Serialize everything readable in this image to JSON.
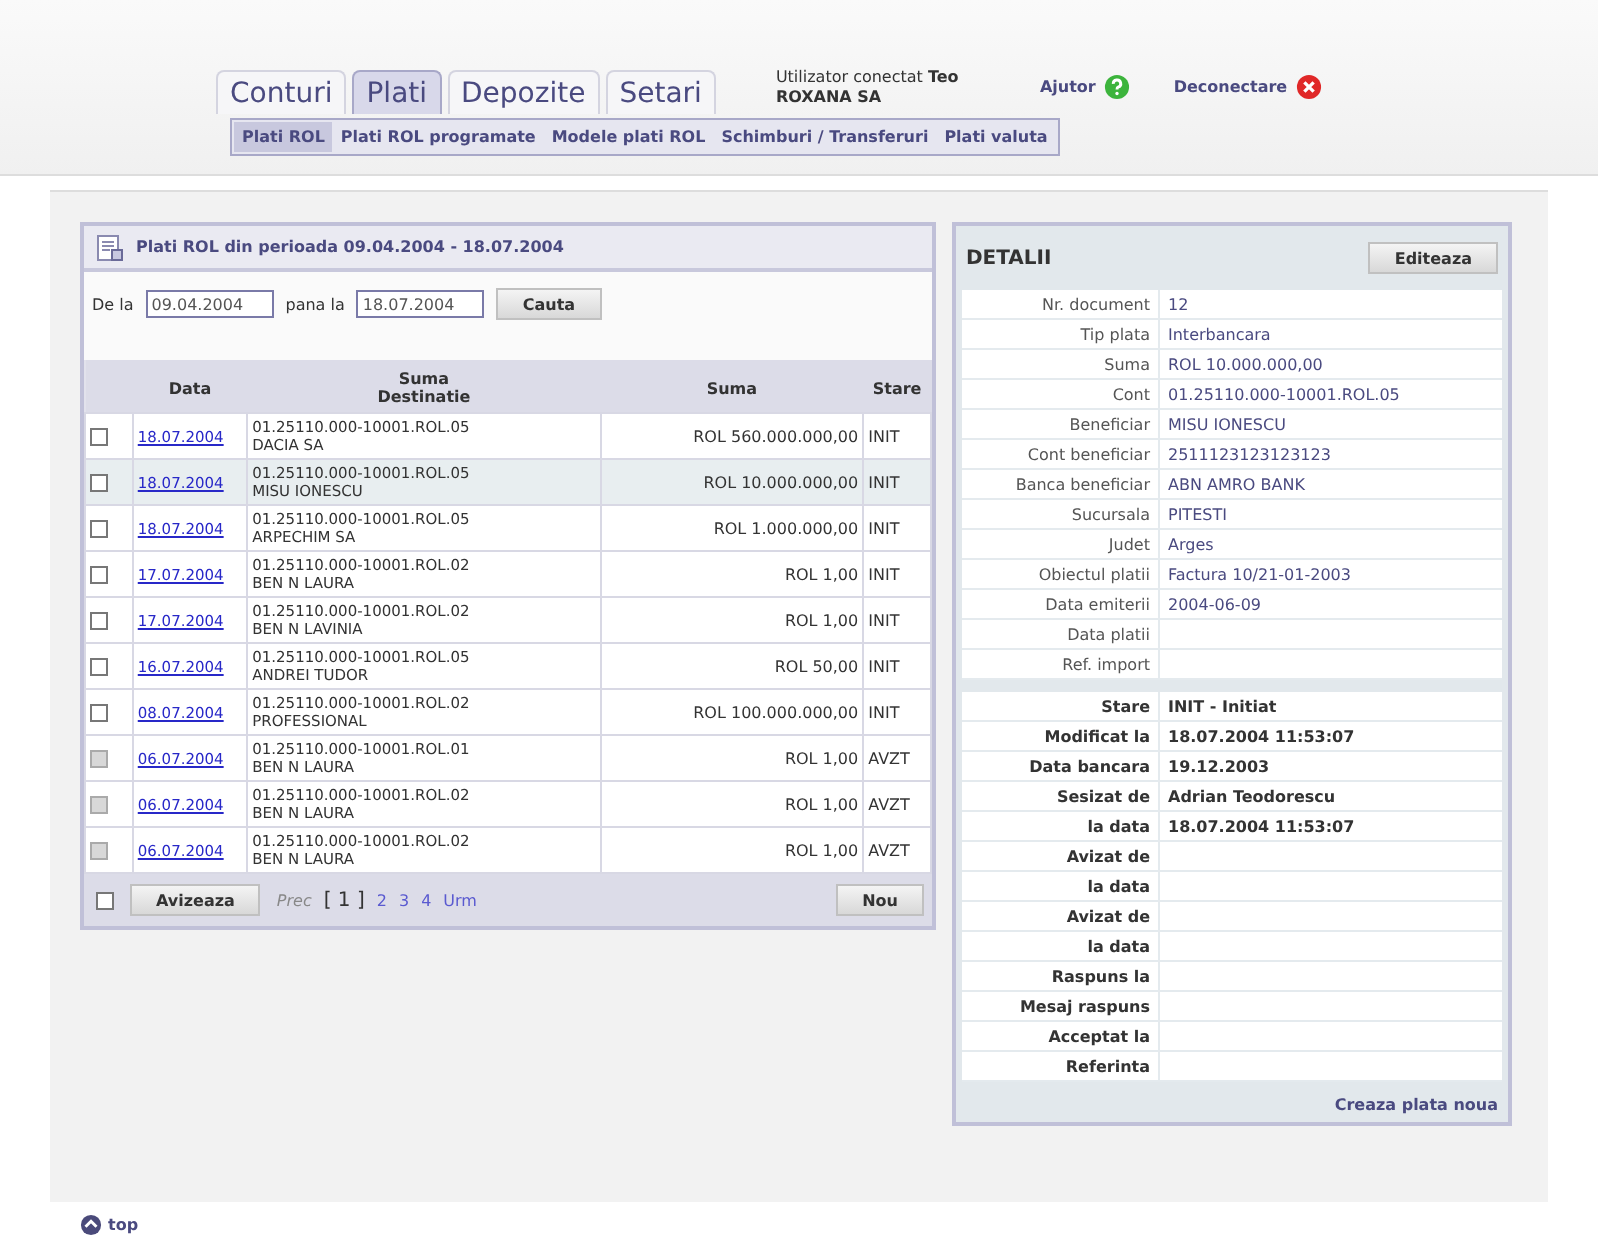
{
  "tabs": [
    {
      "label": "Conturi",
      "selected": false
    },
    {
      "label": "Plati",
      "selected": true
    },
    {
      "label": "Depozite",
      "selected": false
    },
    {
      "label": "Setari",
      "selected": false
    }
  ],
  "user": {
    "label": "Utilizator conectat",
    "name": "Teo",
    "company": "ROXANA SA"
  },
  "help_link": "Ajutor",
  "logout_link": "Deconectare",
  "subtabs": [
    {
      "label": "Plati ROL",
      "selected": true
    },
    {
      "label": "Plati ROL programate",
      "selected": false
    },
    {
      "label": "Modele plati ROL",
      "selected": false
    },
    {
      "label": "Schimburi / Transferuri",
      "selected": false
    },
    {
      "label": "Plati valuta",
      "selected": false
    }
  ],
  "payments": {
    "title": "Plati ROL din perioada 09.04.2004 - 18.07.2004",
    "filter": {
      "from_label": "De la",
      "from_value": "09.04.2004",
      "to_label": "pana la",
      "to_value": "18.07.2004",
      "button": "Cauta"
    },
    "columns": [
      "Data",
      "Suma\nDestinatie",
      "Suma",
      "Stare"
    ],
    "rows": [
      {
        "date": "18.07.2004",
        "account": "01.25110.000-10001.ROL.05",
        "destination": "DACIA SA",
        "amount": "ROL 560.000.000,00",
        "status": "INIT",
        "selected": false,
        "checked": false,
        "disabled": false
      },
      {
        "date": "18.07.2004",
        "account": "01.25110.000-10001.ROL.05",
        "destination": "MISU IONESCU",
        "amount": "ROL 10.000.000,00",
        "status": "INIT",
        "selected": true,
        "checked": false,
        "disabled": false
      },
      {
        "date": "18.07.2004",
        "account": "01.25110.000-10001.ROL.05",
        "destination": "ARPECHIM SA",
        "amount": "ROL 1.000.000,00",
        "status": "INIT",
        "selected": false,
        "checked": false,
        "disabled": false
      },
      {
        "date": "17.07.2004",
        "account": "01.25110.000-10001.ROL.02",
        "destination": "BEN N LAURA",
        "amount": "ROL 1,00",
        "status": "INIT",
        "selected": false,
        "checked": false,
        "disabled": false
      },
      {
        "date": "17.07.2004",
        "account": "01.25110.000-10001.ROL.02",
        "destination": "BEN N LAVINIA",
        "amount": "ROL 1,00",
        "status": "INIT",
        "selected": false,
        "checked": false,
        "disabled": false
      },
      {
        "date": "16.07.2004",
        "account": "01.25110.000-10001.ROL.05",
        "destination": "ANDREI TUDOR",
        "amount": "ROL 50,00",
        "status": "INIT",
        "selected": false,
        "checked": false,
        "disabled": false
      },
      {
        "date": "08.07.2004",
        "account": "01.25110.000-10001.ROL.02",
        "destination": "PROFESSIONAL",
        "amount": "ROL 100.000.000,00",
        "status": "INIT",
        "selected": false,
        "checked": false,
        "disabled": false
      },
      {
        "date": "06.07.2004",
        "account": "01.25110.000-10001.ROL.01",
        "destination": "BEN N LAURA",
        "amount": "ROL 1,00",
        "status": "AVZT",
        "selected": false,
        "checked": false,
        "disabled": true
      },
      {
        "date": "06.07.2004",
        "account": "01.25110.000-10001.ROL.02",
        "destination": "BEN N LAURA",
        "amount": "ROL 1,00",
        "status": "AVZT",
        "selected": false,
        "checked": false,
        "disabled": true
      },
      {
        "date": "06.07.2004",
        "account": "01.25110.000-10001.ROL.02",
        "destination": "BEN N LAURA",
        "amount": "ROL 1,00",
        "status": "AVZT",
        "selected": false,
        "checked": false,
        "disabled": true
      }
    ],
    "footer": {
      "select_all_checked": false,
      "notify_button": "Avizeaza",
      "prev": {
        "label": "Prec",
        "disabled": true
      },
      "pages": [
        {
          "label": "[ 1 ]",
          "selected": true
        },
        {
          "label": "2",
          "selected": false
        },
        {
          "label": "3",
          "selected": false
        },
        {
          "label": "4",
          "selected": false
        }
      ],
      "next": {
        "label": "Urm",
        "disabled": false
      },
      "new_button": "Nou"
    }
  },
  "details": {
    "title": "DETALII",
    "edit_button": "Editeaza",
    "fields": [
      {
        "label": "Nr. document",
        "value": "12"
      },
      {
        "label": "Tip plata",
        "value": "Interbancara"
      },
      {
        "label": "Suma",
        "value": "ROL 10.000.000,00"
      },
      {
        "label": "Cont",
        "value": "01.25110.000-10001.ROL.05"
      },
      {
        "label": "Beneficiar",
        "value": "MISU IONESCU"
      },
      {
        "label": "Cont beneficiar",
        "value": "2511123123123123"
      },
      {
        "label": "Banca beneficiar",
        "value": "ABN AMRO BANK"
      },
      {
        "label": "Sucursala",
        "value": "PITESTI"
      },
      {
        "label": "Judet",
        "value": "Arges"
      },
      {
        "label": "Obiectul platii",
        "value": "Factura 10/21-01-2003"
      },
      {
        "label": "Data emiterii",
        "value": "2004-06-09"
      },
      {
        "label": "Data platii"
      },
      {
        "label": "Ref. import"
      }
    ],
    "status_fields": [
      {
        "label": "Stare",
        "value": "INIT - Initiat"
      },
      {
        "label": "Modificat la",
        "value": "18.07.2004 11:53:07"
      },
      {
        "label": "Data bancara",
        "value": "19.12.2003"
      },
      {
        "label": "Sesizat de",
        "value": "Adrian Teodorescu"
      },
      {
        "label": "la data",
        "value": "18.07.2004 11:53:07"
      },
      {
        "label": "Avizat de"
      },
      {
        "label": "la data"
      },
      {
        "label": "Avizat de"
      },
      {
        "label": "la data"
      },
      {
        "label": "Raspuns la"
      },
      {
        "label": "Mesaj raspuns"
      },
      {
        "label": "Acceptat la"
      },
      {
        "label": "Referinta"
      }
    ],
    "create_link": "Creaza plata noua"
  },
  "top_link": "top"
}
